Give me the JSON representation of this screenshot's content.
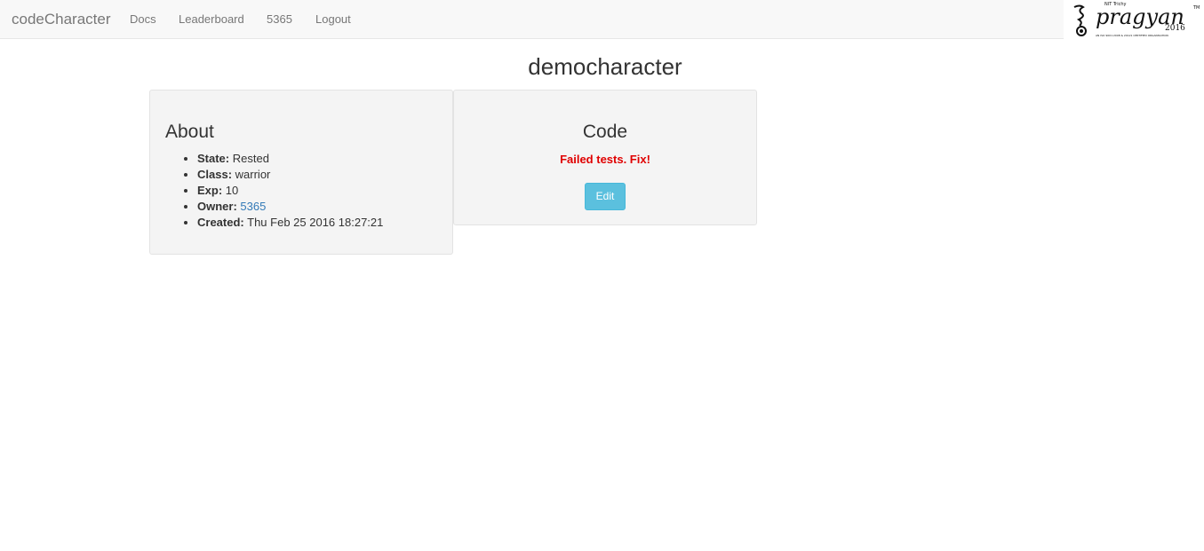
{
  "nav": {
    "brand": "codeCharacter",
    "links": [
      "Docs",
      "Leaderboard",
      "5365",
      "Logout"
    ],
    "logo": {
      "name": "pragyan-logo",
      "text": "pragyan",
      "year": "2016",
      "tag": "NIT Trichy",
      "tm": "TM",
      "tagline": "AN ISO 9001:2008 & 20121 CERTIFIED ORGANISATION"
    }
  },
  "title": "democharacter",
  "about": {
    "heading": "About",
    "items": [
      {
        "label": "State:",
        "value": "Rested"
      },
      {
        "label": "Class:",
        "value": "warrior"
      },
      {
        "label": "Exp:",
        "value": "10"
      },
      {
        "label": "Owner:",
        "value": "5365"
      },
      {
        "label": "Created:",
        "value": "Thu Feb 25 2016 18:27:21"
      }
    ]
  },
  "code": {
    "heading": "Code",
    "status": "Failed tests. Fix!",
    "edit_label": "Edit"
  },
  "colors": {
    "accent": "#5bc0de",
    "error": "#e00000",
    "link": "#337ab7"
  }
}
